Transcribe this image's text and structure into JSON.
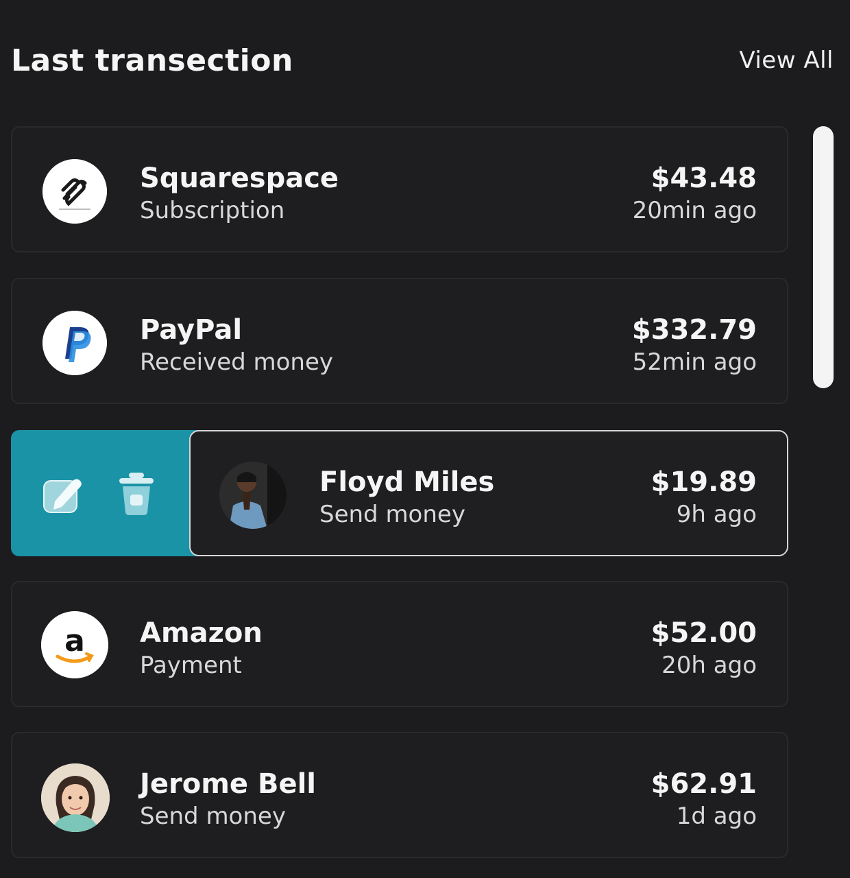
{
  "header": {
    "title": "Last transection",
    "view_all": "View All"
  },
  "transactions": [
    {
      "name": "Squarespace",
      "type": "Subscription",
      "amount": "$43.48",
      "time": "20min ago",
      "icon": "squarespace-logo"
    },
    {
      "name": "PayPal",
      "type": "Received money",
      "amount": "$332.79",
      "time": "52min ago",
      "icon": "paypal-logo"
    },
    {
      "name": "Floyd Miles",
      "type": "Send money",
      "amount": "$19.89",
      "time": "9h ago",
      "icon": "user-avatar"
    },
    {
      "name": "Amazon",
      "type": "Payment",
      "amount": "$52.00",
      "time": "20h ago",
      "icon": "amazon-logo"
    },
    {
      "name": "Jerome Bell",
      "type": "Send money",
      "amount": "$62.91",
      "time": "1d ago",
      "icon": "user-avatar"
    }
  ],
  "swipe_actions": {
    "edit_icon": "edit-icon",
    "delete_icon": "trash-icon"
  },
  "colors": {
    "background": "#1c1c1e",
    "card": "#1e1e20",
    "accent": "#1a93a6",
    "text": "#f5f5f5"
  }
}
